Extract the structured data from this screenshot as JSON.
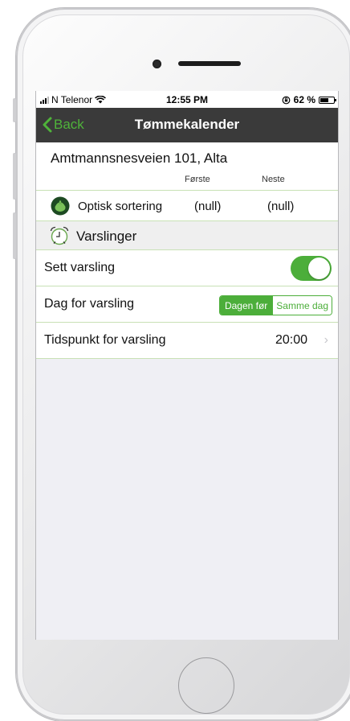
{
  "status_bar": {
    "carrier": "N Telenor",
    "time": "12:55 PM",
    "battery_text": "62 %",
    "battery_level": 0.62
  },
  "nav": {
    "back_label": "Back",
    "title": "Tømmekalender"
  },
  "address": {
    "text": "Amtmannsnesveien 101, Alta",
    "col_first": "Første",
    "col_next": "Neste"
  },
  "waste_row": {
    "label": "Optisk sortering",
    "first": "(null)",
    "next": "(null)"
  },
  "section": {
    "label": "Varslinger"
  },
  "settings": {
    "notify_label": "Sett varsling",
    "notify_on": true,
    "day_label": "Dag for varsling",
    "day_options": [
      "Dagen før",
      "Samme dag"
    ],
    "day_selected": "Dagen før",
    "time_label": "Tidspunkt for varsling",
    "time_value": "20:00"
  },
  "colors": {
    "accent": "#4cae3a",
    "navbar": "#3a3a3a",
    "row_divider": "#c8e1b5"
  }
}
